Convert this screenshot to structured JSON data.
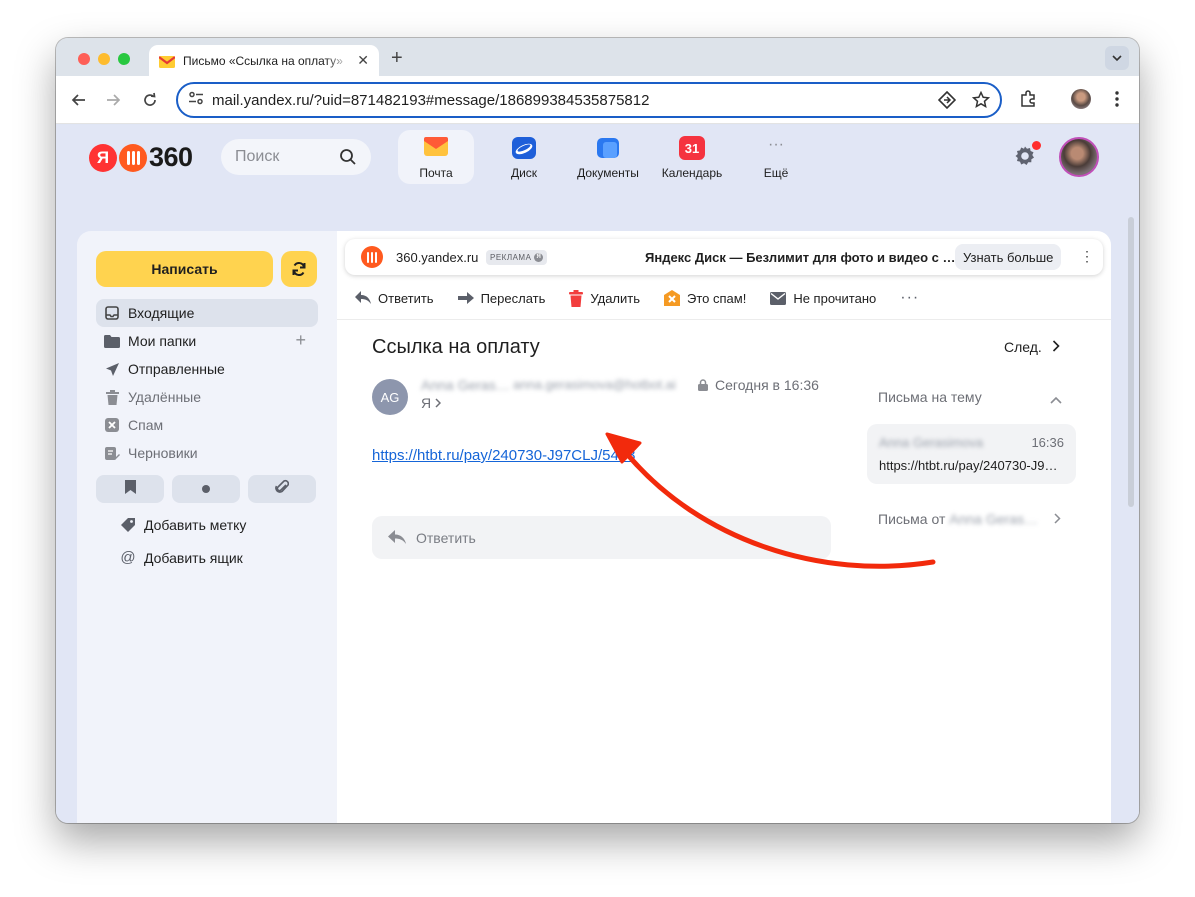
{
  "browser": {
    "tab_title": "Письмо «Ссылка на оплату»",
    "url": "mail.yandex.ru/?uid=871482193#message/186899384535875812"
  },
  "header": {
    "logo_text": "360",
    "search_placeholder": "Поиск",
    "services": [
      {
        "label": "Почта"
      },
      {
        "label": "Диск"
      },
      {
        "label": "Документы"
      },
      {
        "label": "Календарь",
        "badge": "31"
      },
      {
        "label": "Ещё"
      }
    ]
  },
  "sidebar": {
    "compose_label": "Написать",
    "folders": [
      {
        "label": "Входящие"
      },
      {
        "label": "Мои папки"
      },
      {
        "label": "Отправленные"
      },
      {
        "label": "Удалённые"
      },
      {
        "label": "Спам"
      },
      {
        "label": "Черновики"
      }
    ],
    "add_label": "Добавить метку",
    "add_mailbox": "Добавить ящик"
  },
  "ad": {
    "domain": "360.yandex.ru",
    "badge": "РЕКЛАМА",
    "text": "Яндекс Диск — Безлимит для фото и видео с …",
    "button": "Узнать больше"
  },
  "actions": [
    "Ответить",
    "Переслать",
    "Удалить",
    "Это спам!",
    "Не прочитано"
  ],
  "message": {
    "subject": "Ссылка на оплату",
    "next_label": "След.",
    "sender_initials": "AG",
    "sender_name": "Anna Geras…",
    "sender_email": "anna.gerasimova@hotbot.ai",
    "date": "Сегодня в 16:36",
    "to": "Я",
    "link": "https://htbt.ru/pay/240730-J97CLJ/54d3",
    "reply_placeholder": "Ответить"
  },
  "thread": {
    "header": "Письма на тему",
    "item_from": "Anna Gerasimova",
    "item_time": "16:36",
    "item_snippet": "https://htbt.ru/pay/240730-J9…",
    "from_header": "Письма от",
    "from_name": "Anna Geras…"
  },
  "colors": {
    "accent_yellow": "#ffd34f",
    "link_blue": "#1565d8",
    "annotation_arrow": "#f22a0c"
  }
}
